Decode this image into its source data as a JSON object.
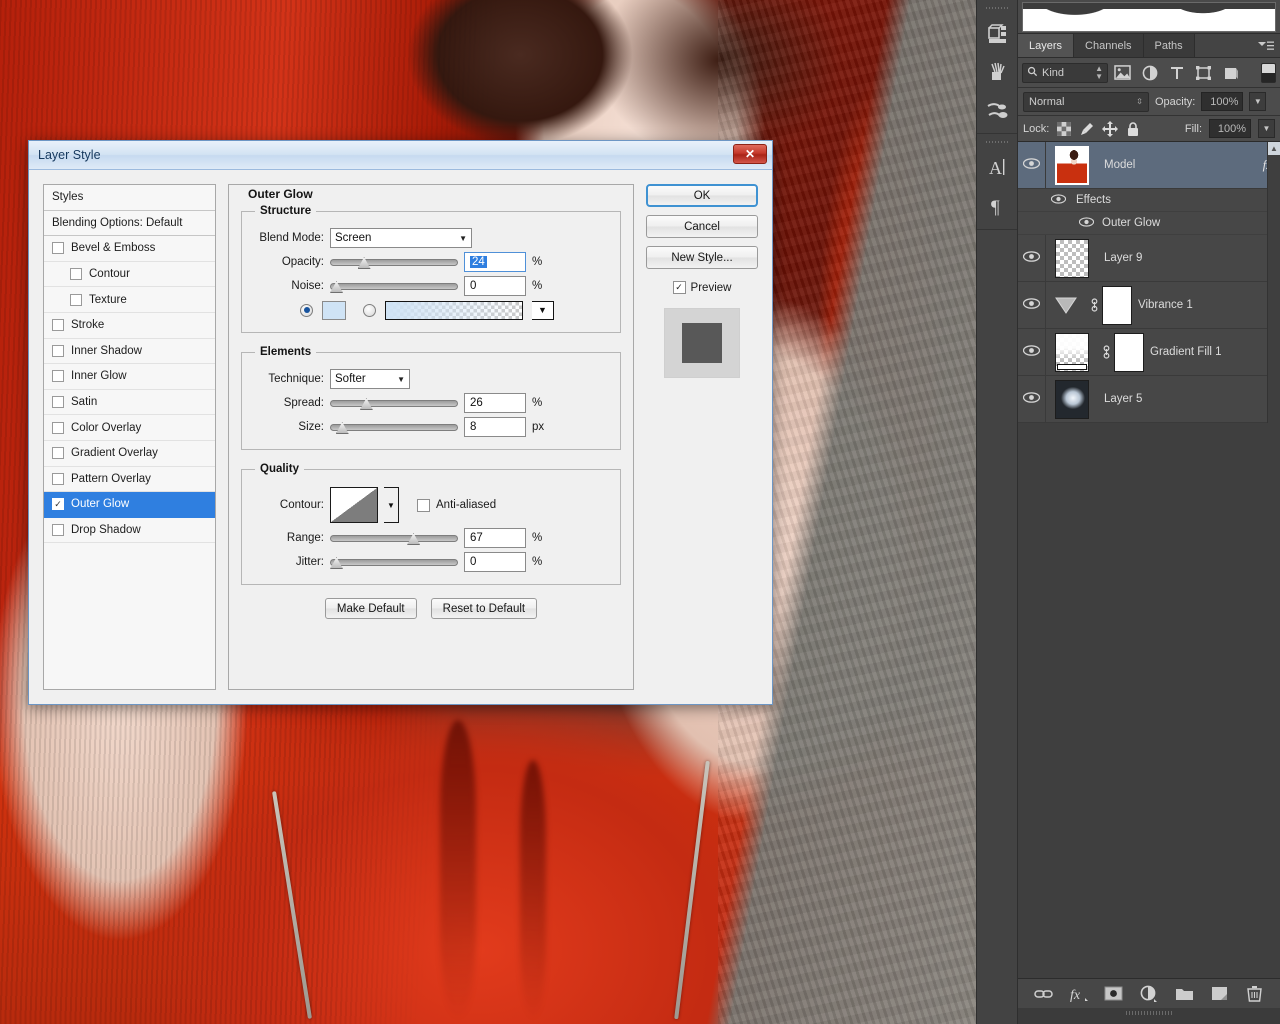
{
  "app": {
    "dock_icons": [
      "3d-panel-icon",
      "brush-presets-icon",
      "brushes-icon",
      "character-panel-icon",
      "paragraph-panel-icon"
    ]
  },
  "panels": {
    "histogram": {
      "name": "histogram-panel"
    },
    "tabs": [
      {
        "label": "Layers",
        "active": true
      },
      {
        "label": "Channels",
        "active": false
      },
      {
        "label": "Paths",
        "active": false
      }
    ],
    "menu_icon": "panel-menu-icon",
    "filter": {
      "kind_label": "Kind",
      "search_icon": "search-icon",
      "icons": [
        "pixel-layer-filter-icon",
        "adjustment-layer-filter-icon",
        "type-layer-filter-icon",
        "shape-layer-filter-icon",
        "smart-object-filter-icon"
      ],
      "toggle_icon": "filter-toggle-icon"
    },
    "blend": {
      "mode": "Normal",
      "opacity_label": "Opacity:",
      "opacity_value": "100%"
    },
    "lock": {
      "label": "Lock:",
      "icons": [
        "lock-transparent-pixels-icon",
        "lock-image-pixels-icon",
        "lock-position-icon",
        "lock-all-icon"
      ],
      "fill_label": "Fill:",
      "fill_value": "100%"
    },
    "layers": [
      {
        "name": "Model",
        "type": "pixel",
        "selected": true,
        "visible": true,
        "has_fx": true,
        "fx_label": "fx",
        "thumb": "model-thumbnail"
      },
      {
        "name": "Effects",
        "type": "effects-group",
        "visible": true,
        "indent": 1
      },
      {
        "name": "Outer Glow",
        "type": "effect",
        "visible": true,
        "indent": 2
      },
      {
        "name": "Layer 9",
        "type": "pixel-empty",
        "visible": true,
        "thumb": "transparent-thumbnail"
      },
      {
        "name": "Vibrance 1",
        "type": "adjustment",
        "visible": true,
        "thumb": "vibrance-adjustment-thumbnail",
        "mask": "white-layer-mask",
        "link_icon": "mask-link-icon"
      },
      {
        "name": "Gradient Fill 1",
        "type": "fill",
        "visible": true,
        "thumb": "gradient-fill-thumbnail",
        "mask": "white-layer-mask",
        "link_icon": "mask-link-icon"
      },
      {
        "name": "Layer 5",
        "type": "pixel",
        "visible": true,
        "thumb": "cloud-thumbnail"
      }
    ],
    "footer_icons": [
      "link-layers-icon",
      "add-layer-style-icon",
      "add-layer-mask-icon",
      "new-adjustment-layer-icon",
      "new-group-icon",
      "new-layer-icon",
      "delete-layer-icon"
    ]
  },
  "dialog": {
    "title": "Layer Style",
    "close_label": "✕",
    "styles_list": [
      {
        "label": "Styles",
        "type": "header"
      },
      {
        "label": "Blending Options: Default",
        "type": "header"
      },
      {
        "label": "Bevel & Emboss",
        "checked": false,
        "indent": 0
      },
      {
        "label": "Contour",
        "checked": false,
        "indent": 1
      },
      {
        "label": "Texture",
        "checked": false,
        "indent": 1
      },
      {
        "label": "Stroke",
        "checked": false,
        "indent": 0
      },
      {
        "label": "Inner Shadow",
        "checked": false,
        "indent": 0
      },
      {
        "label": "Inner Glow",
        "checked": false,
        "indent": 0
      },
      {
        "label": "Satin",
        "checked": false,
        "indent": 0
      },
      {
        "label": "Color Overlay",
        "checked": false,
        "indent": 0
      },
      {
        "label": "Gradient Overlay",
        "checked": false,
        "indent": 0
      },
      {
        "label": "Pattern Overlay",
        "checked": false,
        "indent": 0
      },
      {
        "label": "Outer Glow",
        "checked": true,
        "indent": 0,
        "selected": true
      },
      {
        "label": "Drop Shadow",
        "checked": false,
        "indent": 0
      }
    ],
    "section_title": "Outer Glow",
    "structure": {
      "legend": "Structure",
      "blend_mode_label": "Blend Mode:",
      "blend_mode_value": "Screen",
      "opacity_label": "Opacity:",
      "opacity_value": "24",
      "opacity_unit": "%",
      "opacity_pct": 24,
      "noise_label": "Noise:",
      "noise_value": "0",
      "noise_unit": "%",
      "noise_pct": 0,
      "fill_type": "color",
      "color_swatch": "#cfe3f5",
      "gradient_from": "#cfe3f5"
    },
    "elements": {
      "legend": "Elements",
      "technique_label": "Technique:",
      "technique_value": "Softer",
      "spread_label": "Spread:",
      "spread_value": "26",
      "spread_unit": "%",
      "spread_pct": 26,
      "size_label": "Size:",
      "size_value": "8",
      "size_unit": "px",
      "size_pct": 5
    },
    "quality": {
      "legend": "Quality",
      "contour_label": "Contour:",
      "antialiased_label": "Anti-aliased",
      "antialiased_checked": false,
      "range_label": "Range:",
      "range_value": "67",
      "range_unit": "%",
      "range_pct": 67,
      "jitter_label": "Jitter:",
      "jitter_value": "0",
      "jitter_unit": "%",
      "jitter_pct": 0
    },
    "make_default_label": "Make Default",
    "reset_default_label": "Reset to Default",
    "buttons": {
      "ok": "OK",
      "cancel": "Cancel",
      "new_style": "New Style...",
      "preview_label": "Preview",
      "preview_checked": true
    }
  },
  "colors": {
    "accent_blue": "#2f7fe0",
    "dialog_bg": "#f0f0f0",
    "panel_bg": "#474747",
    "selected_layer": "#5d6b7d",
    "close_red": "#c5392b"
  }
}
